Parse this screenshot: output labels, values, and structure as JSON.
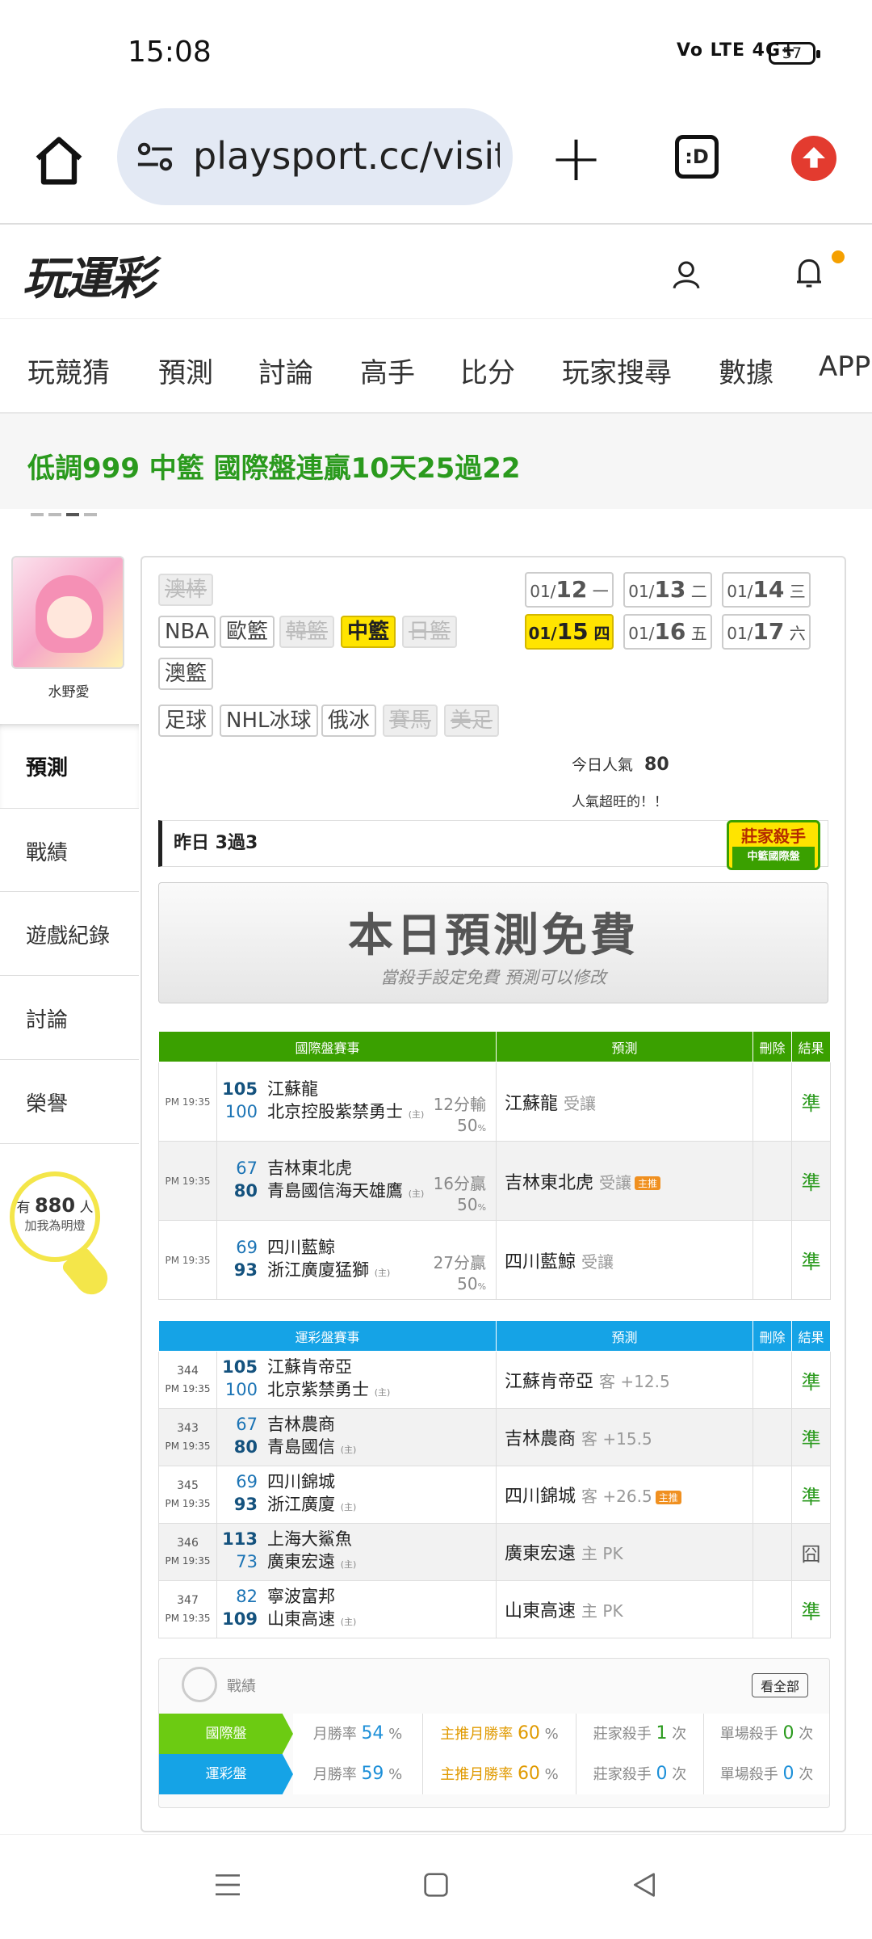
{
  "status": {
    "time": "15:08",
    "signal": "Vo LTE 4G+",
    "battery": "57"
  },
  "browser": {
    "url": "playsport.cc/visit",
    "tabs_label": ":D"
  },
  "site": {
    "logo": "玩運彩"
  },
  "nav": [
    "玩競猜",
    "預測",
    "討論",
    "高手",
    "比分",
    "玩家搜尋",
    "數據",
    "APP"
  ],
  "marquee": "低調999 中籃 國際盤連贏10天25過22",
  "profile": {
    "name": "水野愛",
    "fans_prefix": "有",
    "fans_count": "880",
    "fans_suffix": "人",
    "fans_action": "加我為明燈"
  },
  "sidebar": [
    "預測",
    "戰績",
    "遊戲紀錄",
    "討論",
    "榮譽"
  ],
  "sports": {
    "row1": [
      {
        "label": "澳棒",
        "state": "disabled"
      }
    ],
    "row2": [
      {
        "label": "NBA",
        "state": "normal"
      },
      {
        "label": "歐籃",
        "state": "normal"
      },
      {
        "label": "韓籃",
        "state": "disabled"
      },
      {
        "label": "中籃",
        "state": "selected"
      },
      {
        "label": "日籃",
        "state": "disabled"
      }
    ],
    "row3": [
      {
        "label": "澳籃",
        "state": "normal"
      }
    ],
    "row4": [
      {
        "label": "足球",
        "state": "normal"
      },
      {
        "label": "NHL冰球",
        "state": "normal"
      },
      {
        "label": "俄冰",
        "state": "normal"
      },
      {
        "label": "賽馬",
        "state": "disabled"
      },
      {
        "label": "美足",
        "state": "disabled"
      }
    ]
  },
  "dates": [
    {
      "md": "01/",
      "day": "12",
      "wd": "一",
      "selected": false
    },
    {
      "md": "01/",
      "day": "13",
      "wd": "二",
      "selected": false
    },
    {
      "md": "01/",
      "day": "14",
      "wd": "三",
      "selected": false
    },
    {
      "md": "01/",
      "day": "15",
      "wd": "四",
      "selected": true
    },
    {
      "md": "01/",
      "day": "16",
      "wd": "五",
      "selected": false
    },
    {
      "md": "01/",
      "day": "17",
      "wd": "六",
      "selected": false
    }
  ],
  "popularity": {
    "label": "今日人氣",
    "value": "80",
    "note": "人氣超旺的！！"
  },
  "yesterday": "昨日 3過3",
  "killer_badge": {
    "title": "莊家殺手",
    "sub": "中籃國際盤"
  },
  "free_banner": {
    "title": "本日預測免費",
    "sub": "當殺手設定免費  預測可以修改"
  },
  "intl_table": {
    "headers": [
      "國際盤賽事",
      "預測",
      "刪除",
      "結果"
    ],
    "rows": [
      {
        "time": "PM 19:35",
        "s1": "105",
        "t1": "江蘇龍",
        "s2": "100",
        "t2": "北京控股紫禁勇士",
        "home": "(主)",
        "hc": "12分輸",
        "pct": "50",
        "pred": "江蘇龍",
        "ph": "受讓",
        "hot": "",
        "res": "準"
      },
      {
        "time": "PM 19:35",
        "s1": "67",
        "t1": "吉林東北虎",
        "s2": "80",
        "t2": "青島國信海天雄鷹",
        "home": "(主)",
        "hc": "16分贏",
        "pct": "50",
        "pred": "吉林東北虎",
        "ph": "受讓",
        "hot": "主推",
        "res": "準"
      },
      {
        "time": "PM 19:35",
        "s1": "69",
        "t1": "四川藍鯨",
        "s2": "93",
        "t2": "浙江廣廈猛獅",
        "home": "(主)",
        "hc": "27分贏",
        "pct": "50",
        "pred": "四川藍鯨",
        "ph": "受讓",
        "hot": "",
        "res": "準"
      }
    ]
  },
  "local_table": {
    "headers": [
      "運彩盤賽事",
      "預測",
      "刪除",
      "結果"
    ],
    "rows": [
      {
        "no": "344",
        "time": "PM 19:35",
        "s1": "105",
        "t1": "江蘇肯帝亞",
        "s2": "100",
        "t2": "北京紫禁勇士",
        "home": "(主)",
        "pred": "江蘇肯帝亞",
        "ph": "客 +12.5",
        "hot": "",
        "res": "準"
      },
      {
        "no": "343",
        "time": "PM 19:35",
        "s1": "67",
        "t1": "吉林農商",
        "s2": "80",
        "t2": "青島國信",
        "home": "(主)",
        "pred": "吉林農商",
        "ph": "客 +15.5",
        "hot": "",
        "res": "準"
      },
      {
        "no": "345",
        "time": "PM 19:35",
        "s1": "69",
        "t1": "四川錦城",
        "s2": "93",
        "t2": "浙江廣廈",
        "home": "(主)",
        "pred": "四川錦城",
        "ph": "客 +26.5",
        "hot": "主推",
        "res": "準"
      },
      {
        "no": "346",
        "time": "PM 19:35",
        "s1": "113",
        "t1": "上海大鯊魚",
        "s2": "73",
        "t2": "廣東宏遠",
        "home": "(主)",
        "pred": "廣東宏遠",
        "ph": "主 PK",
        "hot": "",
        "res": "囧"
      },
      {
        "no": "347",
        "time": "PM 19:35",
        "s1": "82",
        "t1": "寧波富邦",
        "s2": "109",
        "t2": "山東高速",
        "home": "(主)",
        "pred": "山東高速",
        "ph": "主 PK",
        "hot": "",
        "res": "準"
      }
    ]
  },
  "stats": {
    "title": "戰績",
    "view_all": "看全部",
    "rows": [
      {
        "label": "國際盤",
        "color": "#6ccb12",
        "month_label": "月勝率",
        "month": "54",
        "main_label": "主推月勝率",
        "main": "60",
        "killer_label": "莊家殺手",
        "killer": "1",
        "single_label": "單場殺手",
        "single": "0",
        "unit": "次",
        "pct": "%"
      },
      {
        "label": "運彩盤",
        "color": "#15a3e6",
        "month_label": "月勝率",
        "month": "59",
        "main_label": "主推月勝率",
        "main": "60",
        "killer_label": "莊家殺手",
        "killer": "0",
        "single_label": "單場殺手",
        "single": "0",
        "unit": "次",
        "pct": "%"
      }
    ]
  }
}
